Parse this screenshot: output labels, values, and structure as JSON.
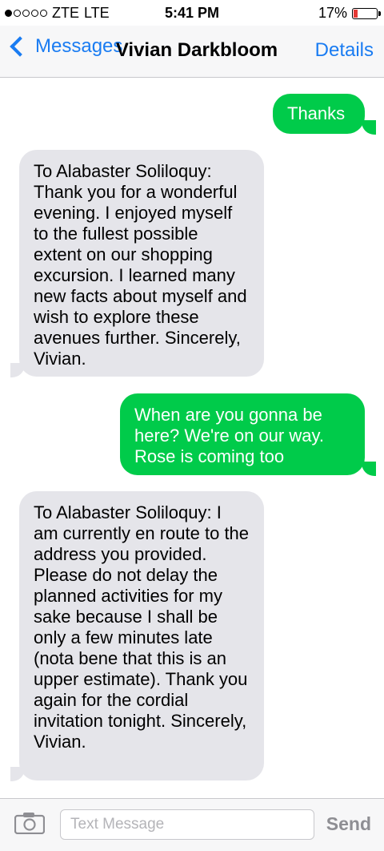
{
  "status": {
    "carrier": "ZTE",
    "network": "LTE",
    "time": "5:41 PM",
    "battery": "17%",
    "battery_level": 0.17,
    "signal_bars_filled": 1,
    "signal_bars_total": 5
  },
  "nav": {
    "back_label": "Messages",
    "title": "Vivian Darkbloom",
    "details_label": "Details"
  },
  "messages": [
    {
      "direction": "sent",
      "text": "Thanks"
    },
    {
      "direction": "received",
      "text": "To Alabaster Soliloquy: Thank you for a wonderful evening. I enjoyed myself to the fullest possible extent on our shopping excursion. I learned many new facts about myself and wish to explore these avenues further. Sincerely, Vivian."
    },
    {
      "direction": "sent",
      "text": "When are you gonna be here? We're on our way. Rose is coming too"
    },
    {
      "direction": "received",
      "text": "To Alabaster Soliloquy: I am currently en route to the address you provided. Please do not delay the planned activities for my sake because I shall be only a few minutes late (nota bene that this is an upper estimate). Thank you again for the cordial invitation tonight. Sincerely, Vivian."
    }
  ],
  "composer": {
    "placeholder": "Text Message",
    "send_label": "Send"
  },
  "colors": {
    "accent": "#1a7cf2",
    "sent_bubble": "#00cb4a",
    "received_bubble": "#e5e5ea",
    "battery_low": "#e53935"
  }
}
